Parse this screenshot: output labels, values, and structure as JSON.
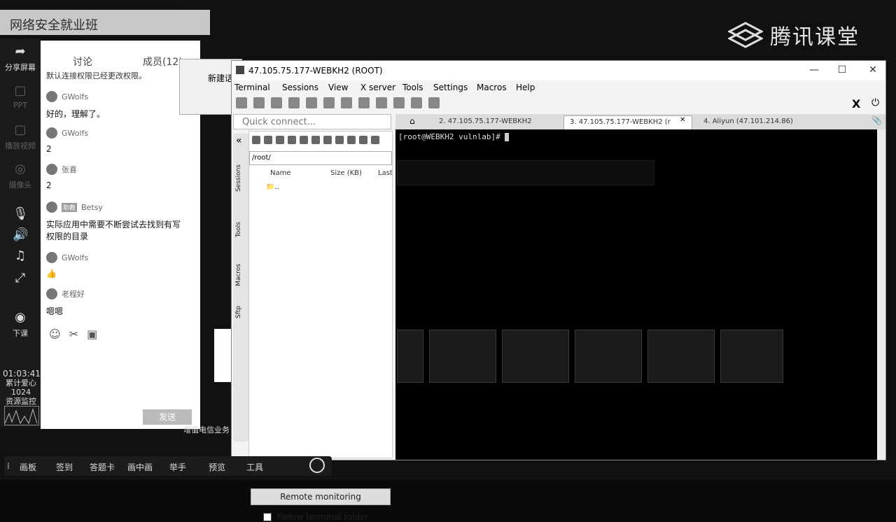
{
  "brand": {
    "name": "腾讯课堂"
  },
  "banner": {
    "title": "网络安全就业班"
  },
  "left_toolbar": {
    "items": [
      {
        "label": "分享屏幕",
        "icon": "share-screen-icon"
      },
      {
        "label": "PPT",
        "icon": "ppt-icon"
      },
      {
        "label": "播放视频",
        "icon": "video-icon"
      },
      {
        "label": "摄像头",
        "icon": "camera-icon"
      },
      {
        "label": "",
        "icon": "mic-icon"
      },
      {
        "label": "",
        "icon": "speaker-icon"
      },
      {
        "label": "",
        "icon": "music-icon"
      },
      {
        "label": "",
        "icon": "fullscreen-icon"
      },
      {
        "label": "下课",
        "icon": "end-class-icon"
      }
    ],
    "clock": "01:03:41",
    "gift_label": "累计爱心",
    "gift_count": "1024",
    "resource": "资源监控"
  },
  "chat": {
    "tab_discuss": "讨论",
    "tab_members": "成员(12)",
    "top_text": "默认连接权限已经更改权限。",
    "messages": [
      {
        "user": "GWolfs",
        "text": "好的，理解了。"
      },
      {
        "user": "GWolfs",
        "text": "2"
      },
      {
        "user": "张喜",
        "text": "2"
      },
      {
        "user": "Betsy",
        "badge": "助教",
        "text": "实际应用中需要不断尝试去找到有写权限的目录"
      },
      {
        "user": "GWolfs",
        "text": "👍"
      },
      {
        "user": "老程好",
        "text": "嗯嗯"
      }
    ],
    "send_label": "发送"
  },
  "mid_window": {
    "label": "新建话"
  },
  "mid_bottom_text": "增值电信业务",
  "moba": {
    "title": "47.105.75.177-WEBKH2 (ROOT)",
    "menu": [
      "Terminal",
      "Sessions",
      "View",
      "X server",
      "Tools",
      "Settings",
      "Macros",
      "Help"
    ],
    "quick_connect": "Quick connect...",
    "side_tabs": [
      "Sessions",
      "Tools",
      "Macros",
      "Sftp"
    ],
    "sftp_path": "/root/",
    "sftp_cols": [
      "Name",
      "Size (KB)",
      "Last"
    ],
    "sftp_row": "..",
    "remote_monitoring": "Remote monitoring",
    "follow_folder": "Follow terminal folder",
    "tabs": [
      {
        "label": "2. 47.105.75.177-WEBKH2",
        "active": false
      },
      {
        "label": "3. 47.105.75.177-WEBKH2 (r",
        "active": true
      },
      {
        "label": "4. Aliyun (47.101.214.86)",
        "active": false
      }
    ],
    "prompt": "[root@WEBKH2 vulnlab]#"
  },
  "bottom_bar": {
    "items": [
      "画板",
      "签到",
      "答题卡",
      "画中画",
      "举手",
      "预览",
      "工具"
    ]
  }
}
